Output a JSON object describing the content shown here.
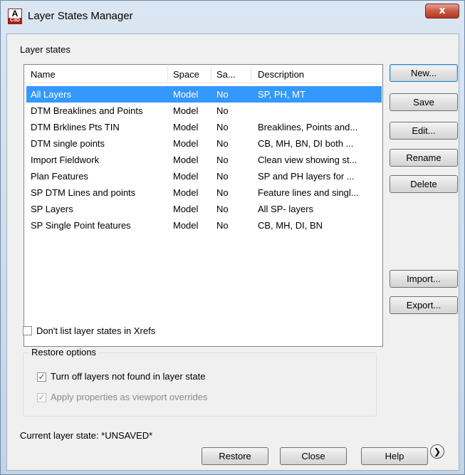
{
  "window": {
    "title": "Layer States Manager",
    "close_glyph": "x",
    "app_icon_letter": "A",
    "app_icon_badge": "C3D"
  },
  "layer_states": {
    "group_label": "Layer states",
    "columns": [
      "Name",
      "Space",
      "Sa...",
      "Description"
    ],
    "rows": [
      {
        "name": "All Layers",
        "space": "Model",
        "saved": "No",
        "description": "SP, PH, MT",
        "selected": true
      },
      {
        "name": "DTM Breaklines and Points",
        "space": "Model",
        "saved": "No",
        "description": ""
      },
      {
        "name": "DTM Brklines Pts TIN",
        "space": "Model",
        "saved": "No",
        "description": "Breaklines, Points and..."
      },
      {
        "name": "DTM single points",
        "space": "Model",
        "saved": "No",
        "description": "CB, MH, BN, DI both ..."
      },
      {
        "name": "Import Fieldwork",
        "space": "Model",
        "saved": "No",
        "description": "Clean view showing st..."
      },
      {
        "name": "Plan Features",
        "space": "Model",
        "saved": "No",
        "description": "SP and PH layers for ..."
      },
      {
        "name": "SP DTM Lines and points",
        "space": "Model",
        "saved": "No",
        "description": "Feature lines and singl..."
      },
      {
        "name": "SP Layers",
        "space": "Model",
        "saved": "No",
        "description": "All SP- layers"
      },
      {
        "name": "SP Single Point features",
        "space": "Model",
        "saved": "No",
        "description": "CB, MH, DI, BN"
      }
    ]
  },
  "side_buttons": {
    "new": "New...",
    "save": "Save",
    "edit": "Edit...",
    "rename": "Rename",
    "delete": "Delete",
    "import": "Import...",
    "export": "Export..."
  },
  "xrefs_option": {
    "label": "Don't list layer states in Xrefs",
    "checked": false
  },
  "restore_options": {
    "title": "Restore options",
    "turn_off": {
      "label": "Turn off layers not found in layer state",
      "checked": true
    },
    "apply_props": {
      "label": "Apply properties as viewport overrides",
      "checked": true,
      "disabled": true
    }
  },
  "current_state": "Current layer state: *UNSAVED*",
  "bottom_buttons": {
    "restore": "Restore",
    "close": "Close",
    "help": "Help",
    "more_glyph": "❯"
  },
  "check_glyph": "✓"
}
